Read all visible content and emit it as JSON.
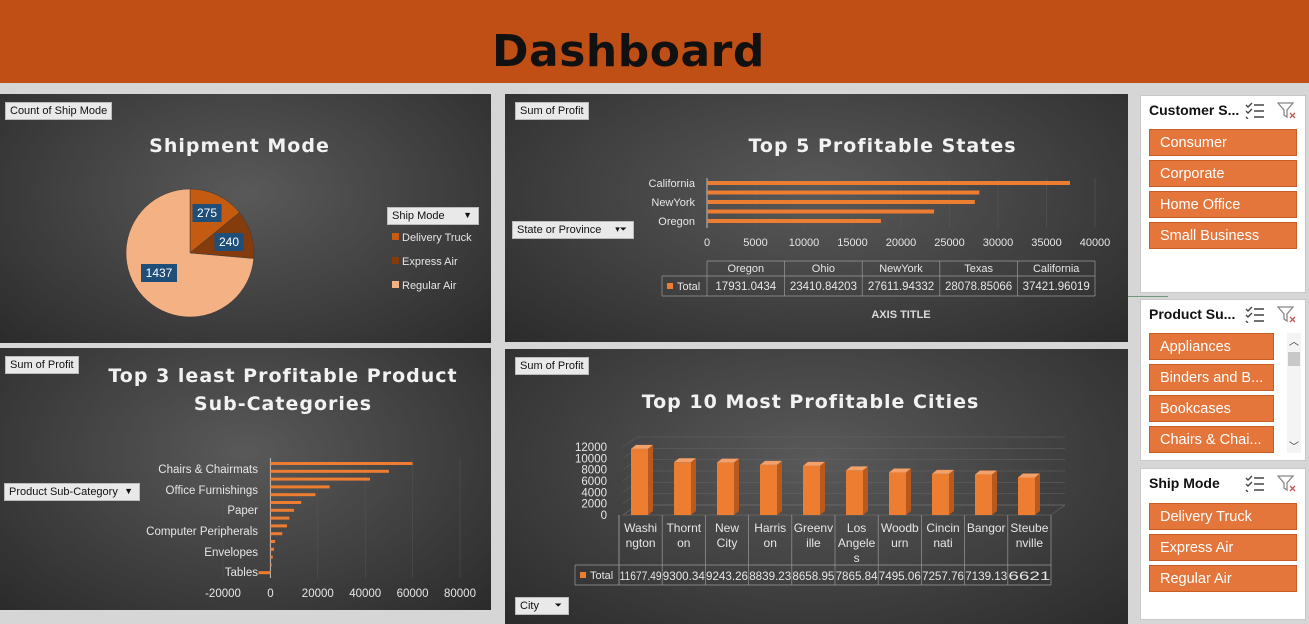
{
  "header": {
    "title": "Dashboard"
  },
  "pie_panel": {
    "field_tag": "Count of Ship Mode",
    "filter_label": "Ship Mode"
  },
  "states_panel": {
    "field_tag": "Sum of Profit",
    "filter_label": "State or Province",
    "axis_title": "AXIS TITLE",
    "table_total_label": "Total"
  },
  "least_panel": {
    "field_tag": "Sum of Profit",
    "filter_label": "Product Sub-Category"
  },
  "cities_panel": {
    "field_tag": "Sum of Profit",
    "filter_label": "City",
    "table_total_label": "Total"
  },
  "slicers": {
    "customer": {
      "title": "Customer S...",
      "items": [
        "Consumer",
        "Corporate",
        "Home Office",
        "Small Business"
      ]
    },
    "product": {
      "title": "Product Su...",
      "items": [
        "Appliances",
        "Binders and B...",
        "Bookcases",
        "Chairs & Chai..."
      ]
    },
    "shipmode": {
      "title": "Ship Mode",
      "items": [
        "Delivery Truck",
        "Express Air",
        "Regular Air"
      ]
    }
  },
  "colors": {
    "accent": "#ed7d31",
    "header": "#c04f15",
    "pie_light": "#f4b183",
    "pie_dark": "#843c0c",
    "pie_mid": "#c55a11"
  },
  "chart_data": [
    {
      "type": "pie",
      "title": "Shipment Mode",
      "categories": [
        "Delivery Truck",
        "Express Air",
        "Regular Air"
      ],
      "values": [
        275,
        240,
        1437
      ],
      "legend": "right"
    },
    {
      "type": "bar",
      "orientation": "horizontal",
      "title": "Top 5 Profitable States",
      "categories": [
        "Oregon",
        "Ohio",
        "NewYork",
        "Texas",
        "California"
      ],
      "axis_categories": [
        "California",
        "NewYork",
        "Oregon"
      ],
      "table_values": [
        "17931.0434",
        "23410.84203",
        "27611.94332",
        "28078.85066",
        "37421.96019"
      ],
      "values": [
        17931.0434,
        23410.84203,
        27611.94332,
        28078.85066,
        37421.96019
      ],
      "xlim": [
        0,
        40000
      ],
      "x_ticks": [
        "0",
        "5000",
        "10000",
        "15000",
        "20000",
        "25000",
        "30000",
        "35000",
        "40000"
      ],
      "series": [
        {
          "name": "Total"
        }
      ],
      "xlabel": "AXIS TITLE"
    },
    {
      "type": "bar",
      "orientation": "horizontal",
      "title": "Top 3 least Profitable Product Sub-Categories",
      "axis_labels": [
        "Chairs & Chairmats",
        "Office Furnishings",
        "Paper",
        "Computer Peripherals",
        "Envelopes",
        "Tables"
      ],
      "values": [
        60000,
        50000,
        42000,
        25000,
        19000,
        13000,
        10000,
        8000,
        7000,
        5000,
        2000,
        1500,
        1000,
        500,
        -5000
      ],
      "xlim": [
        -20000,
        80000
      ],
      "x_ticks": [
        "-20000",
        "0",
        "20000",
        "40000",
        "60000",
        "80000"
      ]
    },
    {
      "type": "bar",
      "title": "Top 10 Most Profitable Cities",
      "categories": [
        "Washington",
        "Thornton",
        "New City",
        "Harrison",
        "Greenville",
        "Los Angeles",
        "Woodburn",
        "Cincinnati",
        "Bangor",
        "Steubenville"
      ],
      "category_labels": [
        [
          "Washi",
          "ngton"
        ],
        [
          "Thornt",
          "on"
        ],
        [
          "New",
          "City"
        ],
        [
          "Harris",
          "on"
        ],
        [
          "Greenv",
          "ille"
        ],
        [
          "Los",
          "Angele",
          "s"
        ],
        [
          "Woodb",
          "urn"
        ],
        [
          "Cincin",
          "nati"
        ],
        [
          "Bangor"
        ],
        [
          "Steube",
          "nville"
        ]
      ],
      "table_values": [
        "11677.49",
        "9300.34",
        "9243.26",
        "8839.23",
        "8658.95",
        "7865.84",
        "7495.06",
        "7257.76",
        "7139.13",
        "6621"
      ],
      "values": [
        11677.49,
        9300.34,
        9243.26,
        8839.23,
        8658.95,
        7865.84,
        7495.06,
        7257.76,
        7139.13,
        6621
      ],
      "ylim": [
        0,
        12000
      ],
      "y_ticks": [
        "0",
        "2000",
        "4000",
        "6000",
        "8000",
        "10000",
        "12000"
      ],
      "series": [
        {
          "name": "Total"
        }
      ]
    }
  ]
}
